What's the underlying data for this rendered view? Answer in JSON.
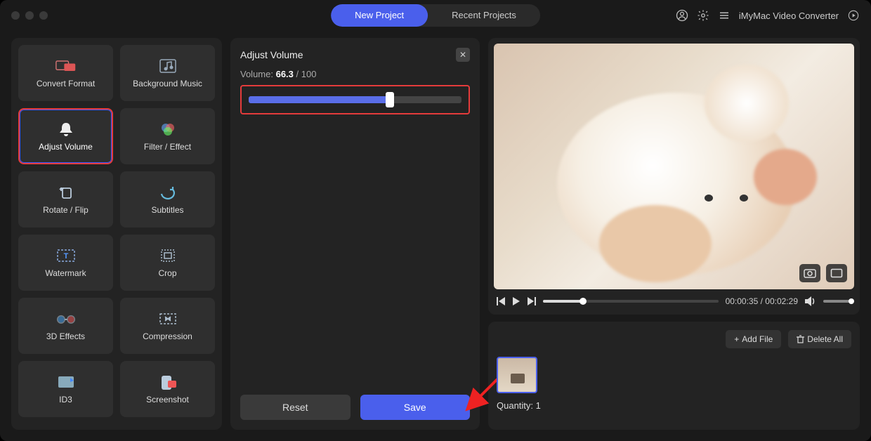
{
  "app": {
    "name": "iMyMac Video Converter"
  },
  "tabs": {
    "new": "New Project",
    "recent": "Recent Projects"
  },
  "sidebar": {
    "items": [
      {
        "label": "Convert Format"
      },
      {
        "label": "Background Music"
      },
      {
        "label": "Adjust Volume"
      },
      {
        "label": "Filter / Effect"
      },
      {
        "label": "Rotate / Flip"
      },
      {
        "label": "Subtitles"
      },
      {
        "label": "Watermark"
      },
      {
        "label": "Crop"
      },
      {
        "label": "3D Effects"
      },
      {
        "label": "Compression"
      },
      {
        "label": "ID3"
      },
      {
        "label": "Screenshot"
      }
    ]
  },
  "panel": {
    "title": "Adjust Volume",
    "volume_prefix": "Volume: ",
    "volume_value": "66.3",
    "volume_suffix": " / 100",
    "slider_percent": 66.3,
    "reset": "Reset",
    "save": "Save"
  },
  "player": {
    "time": "00:00:35 / 00:02:29",
    "progress_percent": 23
  },
  "files": {
    "add": "Add File",
    "delete": "Delete All",
    "quantity_label": "Quantity: ",
    "quantity_value": "1"
  }
}
